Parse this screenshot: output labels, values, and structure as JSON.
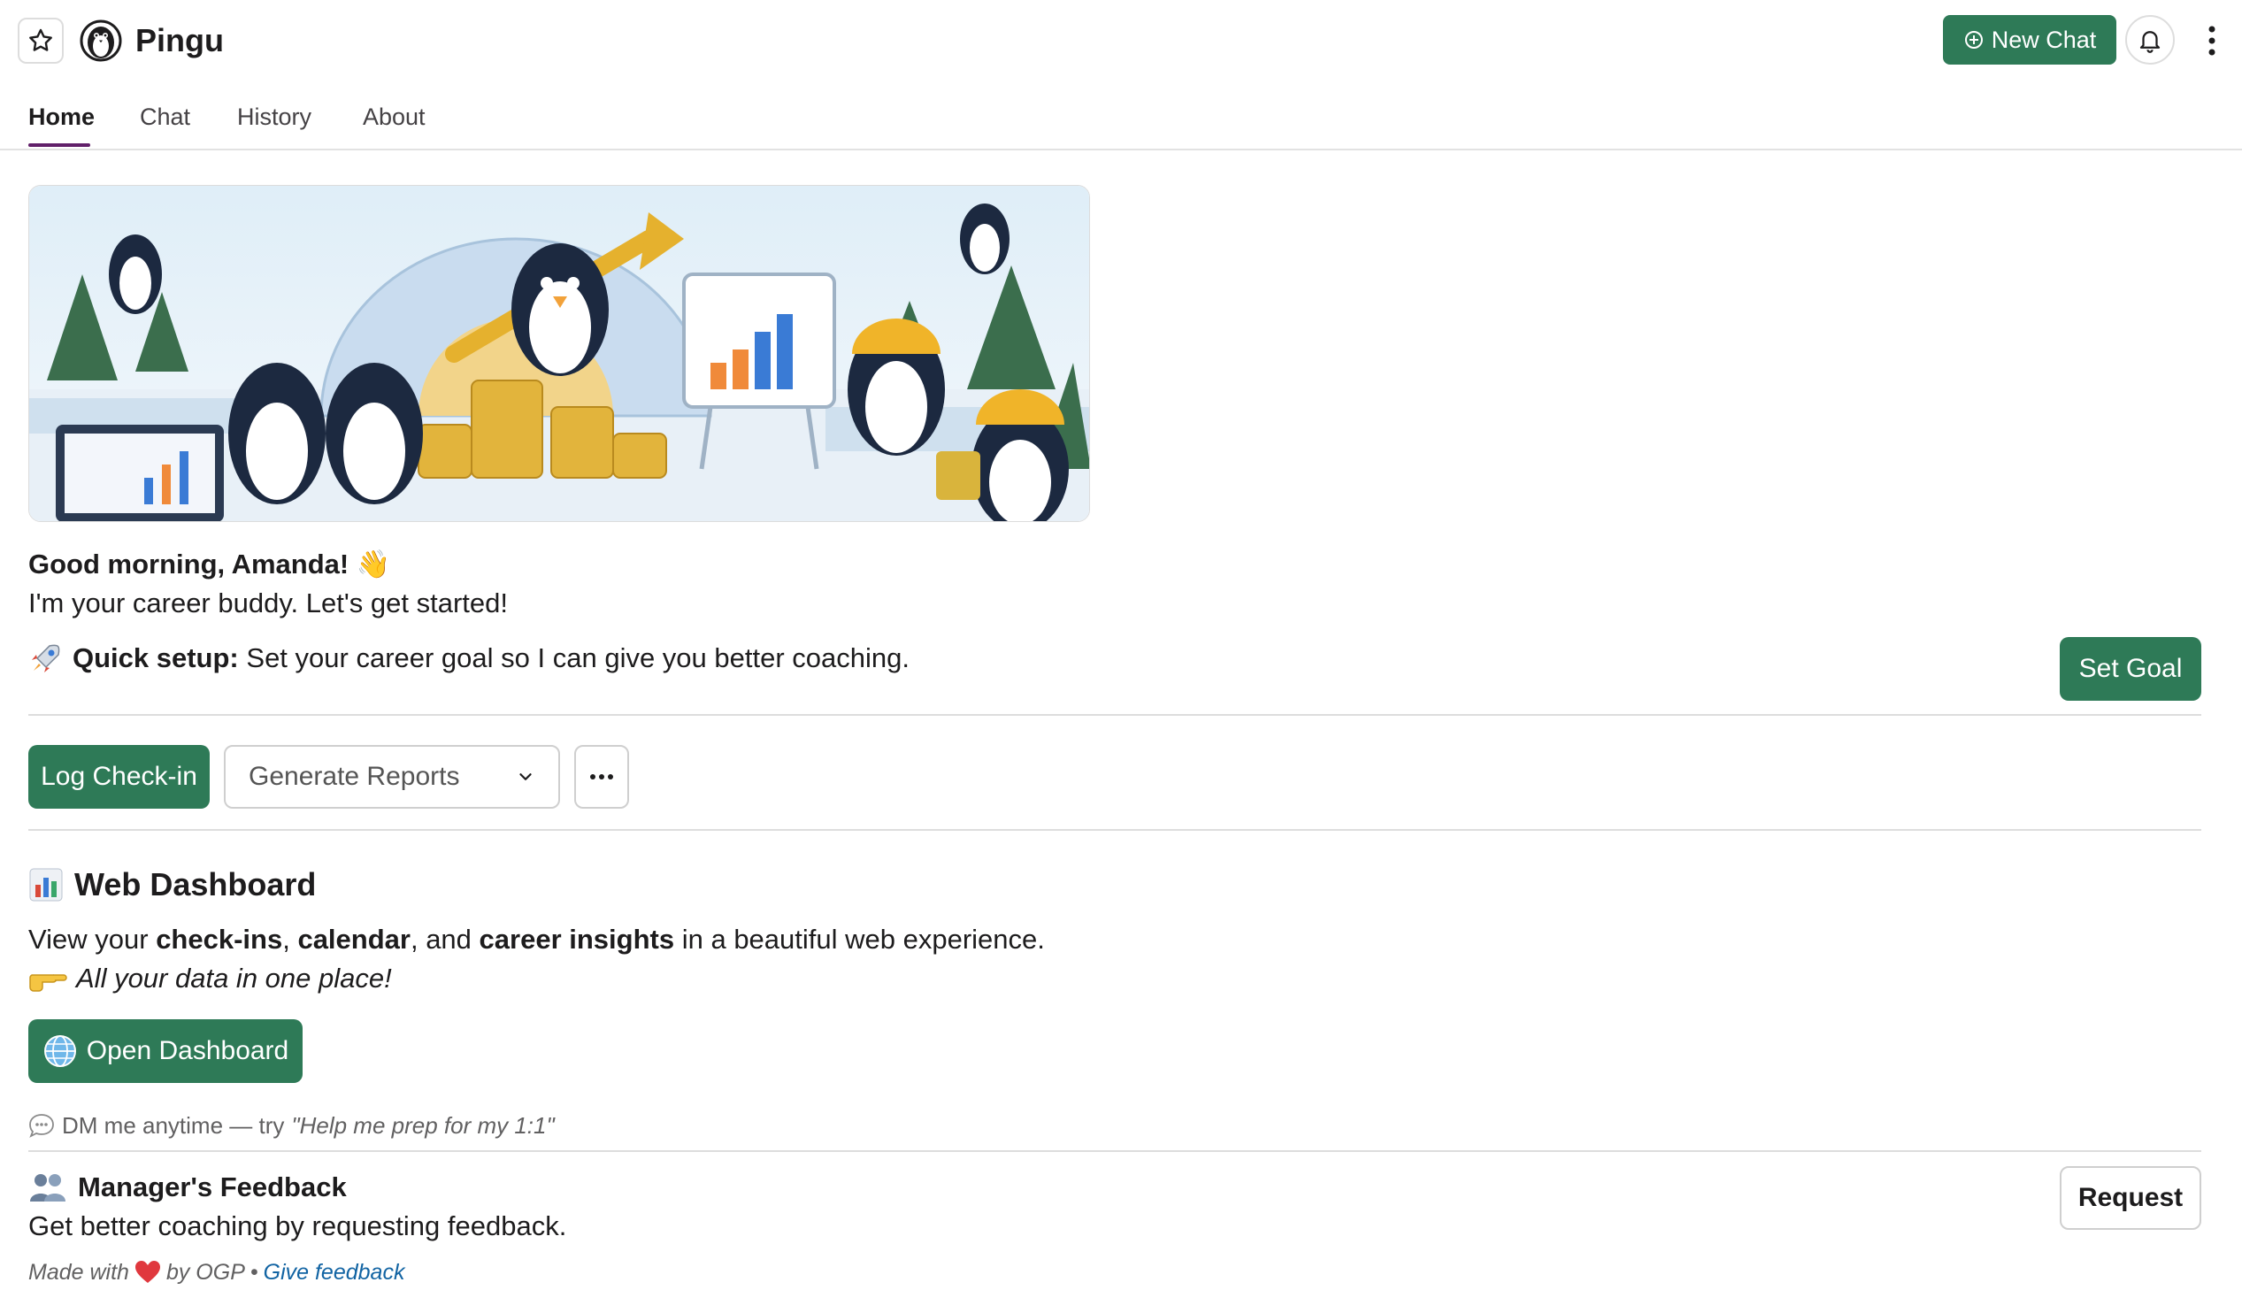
{
  "app": {
    "title": "Pingu"
  },
  "header": {
    "new_chat_label": "New Chat"
  },
  "tabs": [
    {
      "label": "Home",
      "active": true
    },
    {
      "label": "Chat"
    },
    {
      "label": "History"
    },
    {
      "label": "About"
    }
  ],
  "welcome": {
    "greeting": "Good morning, Amanda!",
    "wave_emoji": "👋",
    "subtitle": "I'm your career buddy. Let's get started!",
    "quick_setup_label": "Quick setup:",
    "quick_setup_text": "Set your career goal so I can give you better coaching.",
    "set_goal_label": "Set Goal"
  },
  "actions": {
    "log_checkin_label": "Log Check-in",
    "generate_reports_selected": "Generate Reports",
    "more_label": "···"
  },
  "dashboard": {
    "title": "Web Dashboard",
    "desc_prefix": "View your",
    "desc_b1": "check-ins",
    "desc_sep1": ",",
    "desc_b2": "calendar",
    "desc_sep2": ", and",
    "desc_b3": "career insights",
    "desc_suffix": "in a beautiful web experience.",
    "tagline": "All your data in one place!",
    "open_label": "Open Dashboard"
  },
  "dm_hint": {
    "prefix": "DM me anytime — try",
    "example": "\"Help me prep for my 1:1\""
  },
  "manager_feedback": {
    "title": "Manager's Feedback",
    "desc": "Get better coaching by requesting feedback.",
    "request_label": "Request"
  },
  "footer": {
    "made_with": "Made with",
    "by": "by OGP •",
    "link": "Give feedback"
  },
  "colors": {
    "primary": "#2e7a57",
    "tab_underline": "#611f69",
    "link": "#1264a3"
  }
}
